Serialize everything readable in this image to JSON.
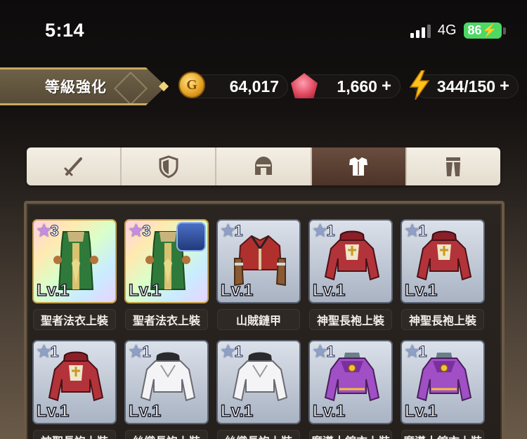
{
  "status_bar": {
    "time": "5:14",
    "network": "4G",
    "battery": "86"
  },
  "header": {
    "title": "等級強化",
    "gold": "64,017",
    "gems": "1,660",
    "stamina": "344/150",
    "plus": "+",
    "coin_letter": "G"
  },
  "tabs": [
    {
      "icon": "sword-icon",
      "active": false
    },
    {
      "icon": "shield-icon",
      "active": false
    },
    {
      "icon": "helmet-icon",
      "active": false
    },
    {
      "icon": "body-armor-icon",
      "active": true
    },
    {
      "icon": "leg-armor-icon",
      "active": false
    }
  ],
  "items": [
    {
      "name": "聖者法衣上裝",
      "stars": "3",
      "level": "Lv.1",
      "rarity": "rainbow",
      "art": "green-robe"
    },
    {
      "name": "聖者法衣上裝",
      "stars": "3",
      "level": "Lv.1",
      "rarity": "rainbow",
      "art": "green-robe"
    },
    {
      "name": "山賊鏈甲",
      "stars": "1",
      "level": "Lv.1",
      "rarity": "normal",
      "art": "red-vest"
    },
    {
      "name": "神聖長袍上裝",
      "stars": "1",
      "level": "Lv.1",
      "rarity": "normal",
      "art": "red-robe"
    },
    {
      "name": "神聖長袍上裝",
      "stars": "1",
      "level": "Lv.1",
      "rarity": "normal",
      "art": "red-robe"
    },
    {
      "name": "神聖長袍上裝",
      "stars": "1",
      "level": "Lv.1",
      "rarity": "normal",
      "art": "red-robe"
    },
    {
      "name": "絲織長袍上裝",
      "stars": "1",
      "level": "Lv.1",
      "rarity": "normal",
      "art": "white-robe"
    },
    {
      "name": "絲織長袍上裝",
      "stars": "1",
      "level": "Lv.1",
      "rarity": "normal",
      "art": "white-robe"
    },
    {
      "name": "魔導士錦衣上裝",
      "stars": "1",
      "level": "Lv.1",
      "rarity": "normal",
      "art": "purple-robe"
    },
    {
      "name": "魔導士錦衣上裝",
      "stars": "1",
      "level": "Lv.1",
      "rarity": "normal",
      "art": "purple-robe"
    }
  ],
  "colors": {
    "accent_gold": "#c9a960",
    "tab_active": "#5a3f32",
    "battery_green": "#4cd964"
  }
}
